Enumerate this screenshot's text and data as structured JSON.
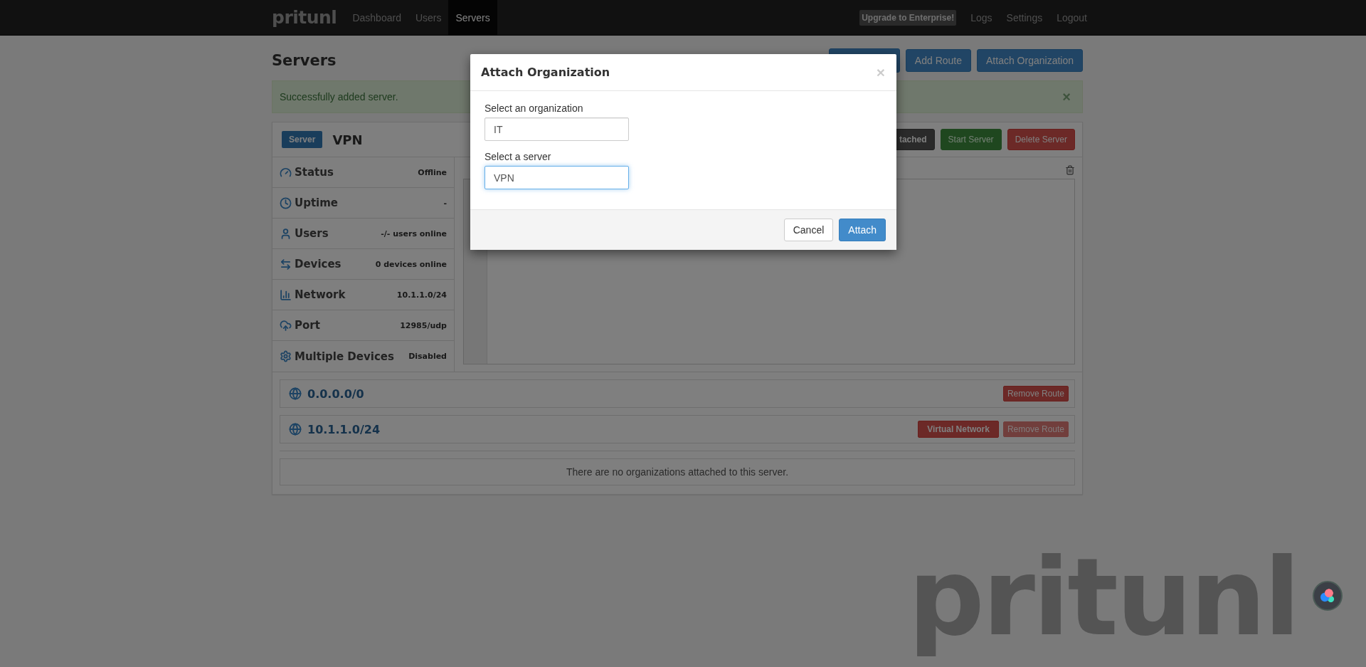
{
  "navbar": {
    "brand": "pritunl",
    "links": [
      {
        "label": "Dashboard",
        "selected": false
      },
      {
        "label": "Users",
        "selected": false
      },
      {
        "label": "Servers",
        "selected": true
      }
    ],
    "upgrade": "Upgrade to Enterprise!",
    "right_links": [
      "Logs",
      "Settings",
      "Logout"
    ]
  },
  "page": {
    "title": "Servers",
    "toolbar_buttons": [
      "Add Route",
      "Attach Organization"
    ]
  },
  "alert": {
    "text": "Successfully added server.",
    "close": "×"
  },
  "server": {
    "badge": "Server",
    "name": "VPN",
    "buttons": [
      {
        "label": "tached",
        "kind": "dark",
        "disabled": false
      },
      {
        "label": "Start Server",
        "kind": "success",
        "disabled": true
      },
      {
        "label": "Delete Server",
        "kind": "danger",
        "disabled": false
      }
    ],
    "stats": [
      {
        "label": "Status",
        "value": "Offline"
      },
      {
        "label": "Uptime",
        "value": "-"
      },
      {
        "label": "Users",
        "value": "-/- users online"
      },
      {
        "label": "Devices",
        "value": "0 devices online"
      },
      {
        "label": "Network",
        "value": "10.1.1.0/24"
      },
      {
        "label": "Port",
        "value": "12985/udp"
      },
      {
        "label": "Multiple Devices",
        "value": "Disabled"
      }
    ],
    "routes": [
      {
        "network": "0.0.0.0/0",
        "tags": [
          {
            "label": "Remove Route",
            "kind": "button",
            "disabled": false
          }
        ]
      },
      {
        "network": "10.1.1.0/24",
        "tags": [
          {
            "label": "Virtual Network",
            "kind": "label",
            "disabled": false
          },
          {
            "label": "Remove Route",
            "kind": "button",
            "disabled": true
          }
        ]
      }
    ],
    "organizations_empty": "There are no organizations attached to this server."
  },
  "modal": {
    "title": "Attach Organization",
    "close": "×",
    "fields": [
      {
        "label": "Select an organization",
        "value": "IT",
        "focused": false
      },
      {
        "label": "Select a server",
        "value": "VPN",
        "focused": true
      }
    ],
    "cancel": "Cancel",
    "submit": "Attach"
  },
  "background_logo": "pritunl"
}
